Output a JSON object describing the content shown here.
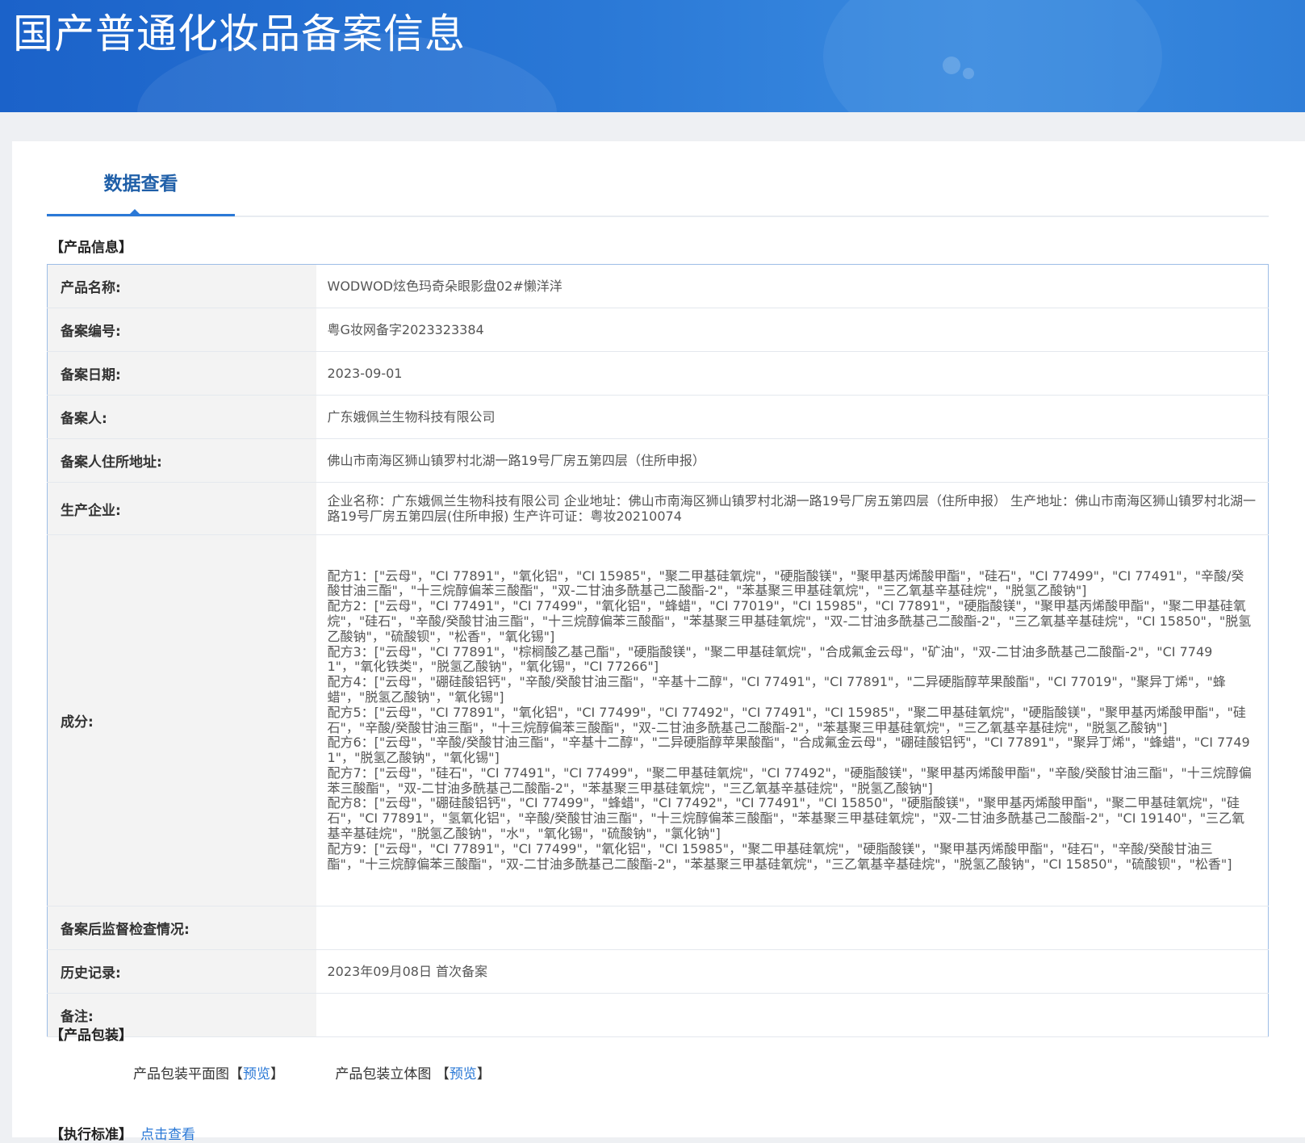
{
  "header": {
    "title": "国产普通化妆品备案信息"
  },
  "tabs": [
    {
      "label": "数据查看",
      "active": true
    }
  ],
  "product_info": {
    "section_title": "【产品信息】",
    "rows": [
      {
        "label": "产品名称:",
        "value": "WODWOD炫色玛奇朵眼影盘02#懒洋洋"
      },
      {
        "label": "备案编号:",
        "value": "粤G妆网备字2023323384"
      },
      {
        "label": "备案日期:",
        "value": "2023-09-01"
      },
      {
        "label": "备案人:",
        "value": "广东娥佩兰生物科技有限公司"
      },
      {
        "label": "备案人住所地址:",
        "value": "佛山市南海区狮山镇罗村北湖一路19号厂房五第四层（住所申报）"
      },
      {
        "label": "生产企业:",
        "value": "企业名称：广东娥佩兰生物科技有限公司 企业地址：佛山市南海区狮山镇罗村北湖一路19号厂房五第四层（住所申报） 生产地址：佛山市南海区狮山镇罗村北湖一路19号厂房五第四层(住所申报) 生产许可证：粤妆20210074"
      },
      {
        "label": "成分:",
        "value": ""
      },
      {
        "label": "备案后监督检查情况:",
        "value": ""
      },
      {
        "label": "历史记录:",
        "value": "2023年09月08日 首次备案"
      },
      {
        "label": "备注:",
        "value": ""
      }
    ],
    "ingredients": [
      "配方1：[\"云母\"，\"CI 77891\"，\"氧化铝\"，\"CI 15985\"，\"聚二甲基硅氧烷\"，\"硬脂酸镁\"，\"聚甲基丙烯酸甲酯\"，\"硅石\"，\"CI 77499\"，\"CI 77491\"，\"辛酸/癸酸甘油三酯\"，\"十三烷醇偏苯三酸酯\"，\"双-二甘油多酰基己二酸酯-2\"，\"苯基聚三甲基硅氧烷\"，\"三乙氧基辛基硅烷\"，\"脱氢乙酸钠\"]",
      "配方2：[\"云母\"，\"CI 77491\"，\"CI 77499\"，\"氧化铝\"，\"蜂蜡\"，\"CI 77019\"，\"CI 15985\"，\"CI 77891\"，\"硬脂酸镁\"，\"聚甲基丙烯酸甲酯\"，\"聚二甲基硅氧烷\"，\"硅石\"，\"辛酸/癸酸甘油三酯\"，\"十三烷醇偏苯三酸酯\"，\"苯基聚三甲基硅氧烷\"，\"双-二甘油多酰基己二酸酯-2\"，\"三乙氧基辛基硅烷\"，\"CI 15850\"，\"脱氢乙酸钠\"，\"硫酸钡\"，\"松香\"，\"氧化锡\"]",
      "配方3：[\"云母\"，\"CI 77891\"，\"棕榈酸乙基己酯\"，\"硬脂酸镁\"，\"聚二甲基硅氧烷\"，\"合成氟金云母\"，\"矿油\"，\"双-二甘油多酰基己二酸酯-2\"，\"CI 77491\"，\"氧化铁类\"，\"脱氢乙酸钠\"，\"氧化锡\"，\"CI 77266\"]",
      "配方4：[\"云母\"，\"硼硅酸铝钙\"，\"辛酸/癸酸甘油三酯\"，\"辛基十二醇\"，\"CI 77491\"，\"CI 77891\"，\"二异硬脂醇苹果酸酯\"，\"CI 77019\"，\"聚异丁烯\"，\"蜂蜡\"，\"脱氢乙酸钠\"，\"氧化锡\"]",
      "配方5：[\"云母\"，\"CI 77891\"，\"氧化铝\"，\"CI 77499\"，\"CI 77492\"，\"CI 77491\"，\"CI 15985\"，\"聚二甲基硅氧烷\"，\"硬脂酸镁\"，\"聚甲基丙烯酸甲酯\"，\"硅石\"，\"辛酸/癸酸甘油三酯\"，\"十三烷醇偏苯三酸酯\"，\"双-二甘油多酰基己二酸酯-2\"，\"苯基聚三甲基硅氧烷\"，\"三乙氧基辛基硅烷\"，\"脱氢乙酸钠\"]",
      "配方6：[\"云母\"，\"辛酸/癸酸甘油三酯\"，\"辛基十二醇\"，\"二异硬脂醇苹果酸酯\"，\"合成氟金云母\"，\"硼硅酸铝钙\"，\"CI 77891\"，\"聚异丁烯\"，\"蜂蜡\"，\"CI 77491\"，\"脱氢乙酸钠\"，\"氧化锡\"]",
      "配方7：[\"云母\"，\"硅石\"，\"CI 77491\"，\"CI 77499\"，\"聚二甲基硅氧烷\"，\"CI 77492\"，\"硬脂酸镁\"，\"聚甲基丙烯酸甲酯\"，\"辛酸/癸酸甘油三酯\"，\"十三烷醇偏苯三酸酯\"，\"双-二甘油多酰基己二酸酯-2\"，\"苯基聚三甲基硅氧烷\"，\"三乙氧基辛基硅烷\"，\"脱氢乙酸钠\"]",
      "配方8：[\"云母\"，\"硼硅酸铝钙\"，\"CI 77499\"，\"蜂蜡\"，\"CI 77492\"，\"CI 77491\"，\"CI 15850\"，\"硬脂酸镁\"，\"聚甲基丙烯酸甲酯\"，\"聚二甲基硅氧烷\"，\"硅石\"，\"CI 77891\"，\"氢氧化铝\"，\"辛酸/癸酸甘油三酯\"，\"十三烷醇偏苯三酸酯\"，\"苯基聚三甲基硅氧烷\"，\"双-二甘油多酰基己二酸酯-2\"，\"CI 19140\"，\"三乙氧基辛基硅烷\"，\"脱氢乙酸钠\"，\"水\"，\"氧化锡\"，\"硫酸钠\"，\"氯化钠\"]",
      "配方9：[\"云母\"，\"CI 77891\"，\"CI 77499\"，\"氧化铝\"，\"CI 15985\"，\"聚二甲基硅氧烷\"，\"硬脂酸镁\"，\"聚甲基丙烯酸甲酯\"，\"硅石\"，\"辛酸/癸酸甘油三酯\"，\"十三烷醇偏苯三酸酯\"，\"双-二甘油多酰基己二酸酯-2\"，\"苯基聚三甲基硅氧烷\"，\"三乙氧基辛基硅烷\"，\"脱氢乙酸钠\"，\"CI 15850\"，\"硫酸钡\"，\"松香\"]"
    ]
  },
  "packaging": {
    "section_title": "【产品包装】",
    "flat_label": "产品包装平面图",
    "solid_label": "产品包装立体图",
    "bracket_open": "【",
    "bracket_close": "】",
    "preview_link": "预览"
  },
  "standard": {
    "section_title": "【执行标准】",
    "link": "点击查看"
  },
  "colors": {
    "banner": "#2a78d6",
    "link": "#2a78d6",
    "tab_text": "#1f5fa8",
    "table_border": "#9dbde6",
    "label_bg": "#f3f3f3"
  }
}
